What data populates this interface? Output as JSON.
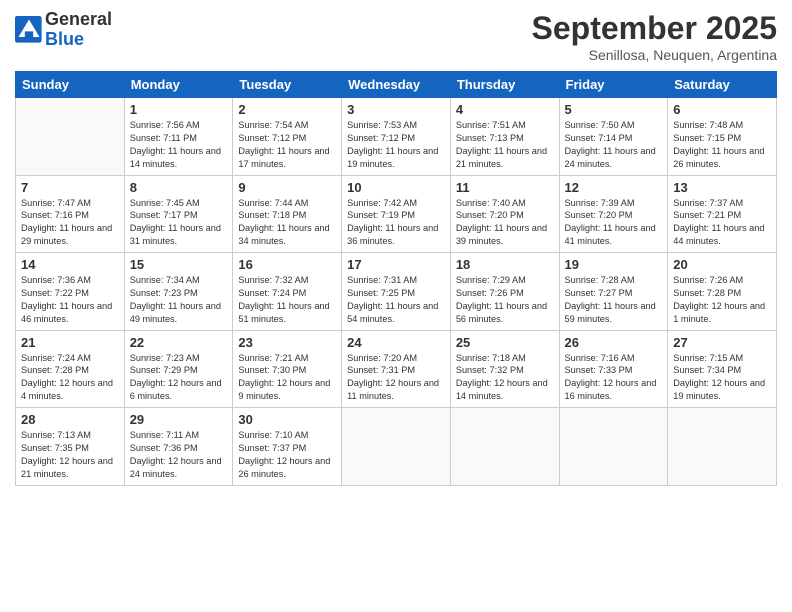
{
  "logo": {
    "line1": "General",
    "line2": "Blue"
  },
  "title": "September 2025",
  "subtitle": "Senillosa, Neuquen, Argentina",
  "days_of_week": [
    "Sunday",
    "Monday",
    "Tuesday",
    "Wednesday",
    "Thursday",
    "Friday",
    "Saturday"
  ],
  "weeks": [
    [
      {
        "day": "",
        "sunrise": "",
        "sunset": "",
        "daylight": ""
      },
      {
        "day": "1",
        "sunrise": "Sunrise: 7:56 AM",
        "sunset": "Sunset: 7:11 PM",
        "daylight": "Daylight: 11 hours and 14 minutes."
      },
      {
        "day": "2",
        "sunrise": "Sunrise: 7:54 AM",
        "sunset": "Sunset: 7:12 PM",
        "daylight": "Daylight: 11 hours and 17 minutes."
      },
      {
        "day": "3",
        "sunrise": "Sunrise: 7:53 AM",
        "sunset": "Sunset: 7:12 PM",
        "daylight": "Daylight: 11 hours and 19 minutes."
      },
      {
        "day": "4",
        "sunrise": "Sunrise: 7:51 AM",
        "sunset": "Sunset: 7:13 PM",
        "daylight": "Daylight: 11 hours and 21 minutes."
      },
      {
        "day": "5",
        "sunrise": "Sunrise: 7:50 AM",
        "sunset": "Sunset: 7:14 PM",
        "daylight": "Daylight: 11 hours and 24 minutes."
      },
      {
        "day": "6",
        "sunrise": "Sunrise: 7:48 AM",
        "sunset": "Sunset: 7:15 PM",
        "daylight": "Daylight: 11 hours and 26 minutes."
      }
    ],
    [
      {
        "day": "7",
        "sunrise": "Sunrise: 7:47 AM",
        "sunset": "Sunset: 7:16 PM",
        "daylight": "Daylight: 11 hours and 29 minutes."
      },
      {
        "day": "8",
        "sunrise": "Sunrise: 7:45 AM",
        "sunset": "Sunset: 7:17 PM",
        "daylight": "Daylight: 11 hours and 31 minutes."
      },
      {
        "day": "9",
        "sunrise": "Sunrise: 7:44 AM",
        "sunset": "Sunset: 7:18 PM",
        "daylight": "Daylight: 11 hours and 34 minutes."
      },
      {
        "day": "10",
        "sunrise": "Sunrise: 7:42 AM",
        "sunset": "Sunset: 7:19 PM",
        "daylight": "Daylight: 11 hours and 36 minutes."
      },
      {
        "day": "11",
        "sunrise": "Sunrise: 7:40 AM",
        "sunset": "Sunset: 7:20 PM",
        "daylight": "Daylight: 11 hours and 39 minutes."
      },
      {
        "day": "12",
        "sunrise": "Sunrise: 7:39 AM",
        "sunset": "Sunset: 7:20 PM",
        "daylight": "Daylight: 11 hours and 41 minutes."
      },
      {
        "day": "13",
        "sunrise": "Sunrise: 7:37 AM",
        "sunset": "Sunset: 7:21 PM",
        "daylight": "Daylight: 11 hours and 44 minutes."
      }
    ],
    [
      {
        "day": "14",
        "sunrise": "Sunrise: 7:36 AM",
        "sunset": "Sunset: 7:22 PM",
        "daylight": "Daylight: 11 hours and 46 minutes."
      },
      {
        "day": "15",
        "sunrise": "Sunrise: 7:34 AM",
        "sunset": "Sunset: 7:23 PM",
        "daylight": "Daylight: 11 hours and 49 minutes."
      },
      {
        "day": "16",
        "sunrise": "Sunrise: 7:32 AM",
        "sunset": "Sunset: 7:24 PM",
        "daylight": "Daylight: 11 hours and 51 minutes."
      },
      {
        "day": "17",
        "sunrise": "Sunrise: 7:31 AM",
        "sunset": "Sunset: 7:25 PM",
        "daylight": "Daylight: 11 hours and 54 minutes."
      },
      {
        "day": "18",
        "sunrise": "Sunrise: 7:29 AM",
        "sunset": "Sunset: 7:26 PM",
        "daylight": "Daylight: 11 hours and 56 minutes."
      },
      {
        "day": "19",
        "sunrise": "Sunrise: 7:28 AM",
        "sunset": "Sunset: 7:27 PM",
        "daylight": "Daylight: 11 hours and 59 minutes."
      },
      {
        "day": "20",
        "sunrise": "Sunrise: 7:26 AM",
        "sunset": "Sunset: 7:28 PM",
        "daylight": "Daylight: 12 hours and 1 minute."
      }
    ],
    [
      {
        "day": "21",
        "sunrise": "Sunrise: 7:24 AM",
        "sunset": "Sunset: 7:28 PM",
        "daylight": "Daylight: 12 hours and 4 minutes."
      },
      {
        "day": "22",
        "sunrise": "Sunrise: 7:23 AM",
        "sunset": "Sunset: 7:29 PM",
        "daylight": "Daylight: 12 hours and 6 minutes."
      },
      {
        "day": "23",
        "sunrise": "Sunrise: 7:21 AM",
        "sunset": "Sunset: 7:30 PM",
        "daylight": "Daylight: 12 hours and 9 minutes."
      },
      {
        "day": "24",
        "sunrise": "Sunrise: 7:20 AM",
        "sunset": "Sunset: 7:31 PM",
        "daylight": "Daylight: 12 hours and 11 minutes."
      },
      {
        "day": "25",
        "sunrise": "Sunrise: 7:18 AM",
        "sunset": "Sunset: 7:32 PM",
        "daylight": "Daylight: 12 hours and 14 minutes."
      },
      {
        "day": "26",
        "sunrise": "Sunrise: 7:16 AM",
        "sunset": "Sunset: 7:33 PM",
        "daylight": "Daylight: 12 hours and 16 minutes."
      },
      {
        "day": "27",
        "sunrise": "Sunrise: 7:15 AM",
        "sunset": "Sunset: 7:34 PM",
        "daylight": "Daylight: 12 hours and 19 minutes."
      }
    ],
    [
      {
        "day": "28",
        "sunrise": "Sunrise: 7:13 AM",
        "sunset": "Sunset: 7:35 PM",
        "daylight": "Daylight: 12 hours and 21 minutes."
      },
      {
        "day": "29",
        "sunrise": "Sunrise: 7:11 AM",
        "sunset": "Sunset: 7:36 PM",
        "daylight": "Daylight: 12 hours and 24 minutes."
      },
      {
        "day": "30",
        "sunrise": "Sunrise: 7:10 AM",
        "sunset": "Sunset: 7:37 PM",
        "daylight": "Daylight: 12 hours and 26 minutes."
      },
      {
        "day": "",
        "sunrise": "",
        "sunset": "",
        "daylight": ""
      },
      {
        "day": "",
        "sunrise": "",
        "sunset": "",
        "daylight": ""
      },
      {
        "day": "",
        "sunrise": "",
        "sunset": "",
        "daylight": ""
      },
      {
        "day": "",
        "sunrise": "",
        "sunset": "",
        "daylight": ""
      }
    ]
  ]
}
